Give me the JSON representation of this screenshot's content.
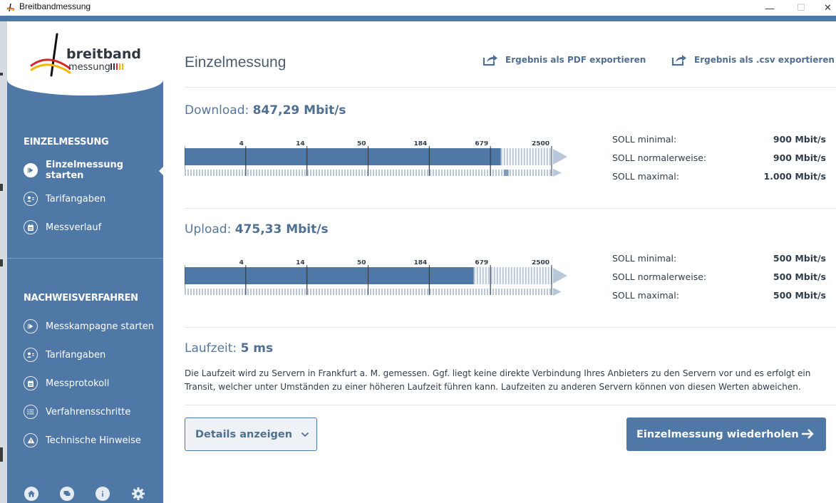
{
  "window": {
    "title": "Breitbandmessung",
    "minimize": "—",
    "maximize": "☐",
    "close": "✕"
  },
  "logo": {
    "word1": "breitband",
    "word2": "messung"
  },
  "sidebar": {
    "section1": "EINZELMESSUNG",
    "section2": "NACHWEISVERFAHREN",
    "items1": [
      {
        "label": "Einzelmessung starten",
        "icon": "play-icon",
        "active": true
      },
      {
        "label": "Tarifangaben",
        "icon": "user-card-icon"
      },
      {
        "label": "Messverlauf",
        "icon": "calendar-icon"
      }
    ],
    "items2": [
      {
        "label": "Messkampagne starten",
        "icon": "play-icon"
      },
      {
        "label": "Tarifangaben",
        "icon": "user-card-icon"
      },
      {
        "label": "Messprotokoll",
        "icon": "calendar-icon"
      },
      {
        "label": "Verfahrensschritte",
        "icon": "list-icon"
      },
      {
        "label": "Technische Hinweise",
        "icon": "warning-icon"
      }
    ],
    "bottom_icons": [
      "home-icon",
      "chat-icon",
      "info-icon",
      "gear-icon"
    ]
  },
  "header": {
    "title": "Einzelmessung",
    "export_pdf": "Ergebnis als PDF exportieren",
    "export_csv": "Ergebnis als .csv exportieren"
  },
  "download": {
    "label": "Download: ",
    "value": "847,29 Mbit/s",
    "measured": 847.29,
    "soll": [
      {
        "label": "SOLL minimal:",
        "value": "900 Mbit/s"
      },
      {
        "label": "SOLL normalerweise:",
        "value": "900 Mbit/s"
      },
      {
        "label": "SOLL maximal:",
        "value": "1.000 Mbit/s"
      }
    ]
  },
  "upload": {
    "label": "Upload: ",
    "value": "475,33 Mbit/s",
    "measured": 475.33,
    "soll": [
      {
        "label": "SOLL minimal:",
        "value": "500 Mbit/s"
      },
      {
        "label": "SOLL normalerweise:",
        "value": "500 Mbit/s"
      },
      {
        "label": "SOLL maximal:",
        "value": "500 Mbit/s"
      }
    ]
  },
  "chart_data": [
    {
      "type": "bar",
      "scale": "log",
      "ticks": [
        4,
        14,
        50,
        184,
        679,
        2500
      ],
      "series": [
        {
          "values": [
            847.29
          ]
        }
      ],
      "target_min": 900,
      "target_max": 1000
    },
    {
      "type": "bar",
      "scale": "log",
      "ticks": [
        4,
        14,
        50,
        184,
        679,
        2500
      ],
      "series": [
        {
          "values": [
            475.33
          ]
        }
      ],
      "target_min": 500,
      "target_max": 500
    }
  ],
  "latency": {
    "label": "Laufzeit: ",
    "value": "5 ms",
    "text": "Die Laufzeit wird zu Servern in Frankfurt a. M. gemessen. Ggf. liegt keine direkte Verbindung Ihres Anbieters zu den Servern vor und es erfolgt ein Transit, welcher unter Umständen zu einer höheren Laufzeit führen kann. Laufzeiten zu anderen Servern können von diesen Werten abweichen."
  },
  "buttons": {
    "details": "Details anzeigen",
    "repeat": "Einzelmessung wiederholen"
  },
  "colors": {
    "accent": "#4f78a6",
    "bar_fill": "#4f78a6",
    "bar_hatch": "#b8c8da",
    "text": "#2f3d4b"
  }
}
